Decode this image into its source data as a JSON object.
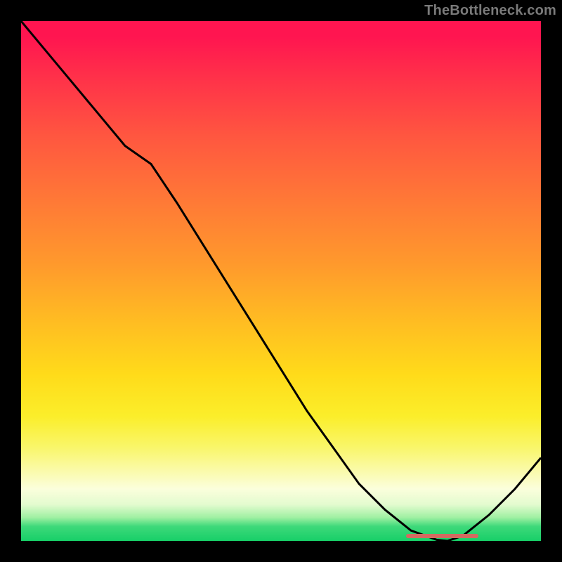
{
  "watermark": "TheBottleneck.com",
  "colors": {
    "curve": "#000000",
    "marker": "#d46a60"
  },
  "chart_data": {
    "type": "line",
    "title": "",
    "xlabel": "",
    "ylabel": "",
    "x": [
      0,
      5,
      10,
      15,
      20,
      25,
      30,
      35,
      40,
      45,
      50,
      55,
      60,
      65,
      70,
      75,
      80,
      82,
      85,
      90,
      95,
      100
    ],
    "values": [
      100,
      94,
      88,
      82,
      76,
      72.5,
      65,
      57,
      49,
      41,
      33,
      25,
      18,
      11,
      6,
      2,
      0.2,
      0,
      1,
      5,
      10,
      16
    ],
    "xlim": [
      0,
      100
    ],
    "ylim": [
      0,
      100
    ],
    "marker_band": {
      "x_start": 74,
      "x_end": 88,
      "y": 0.9
    },
    "notes": "Axes unlabeled; values are normalized percentages of plot width/height estimated from curve geometry. Minimum (bottleneck sweet spot) near x≈82."
  }
}
